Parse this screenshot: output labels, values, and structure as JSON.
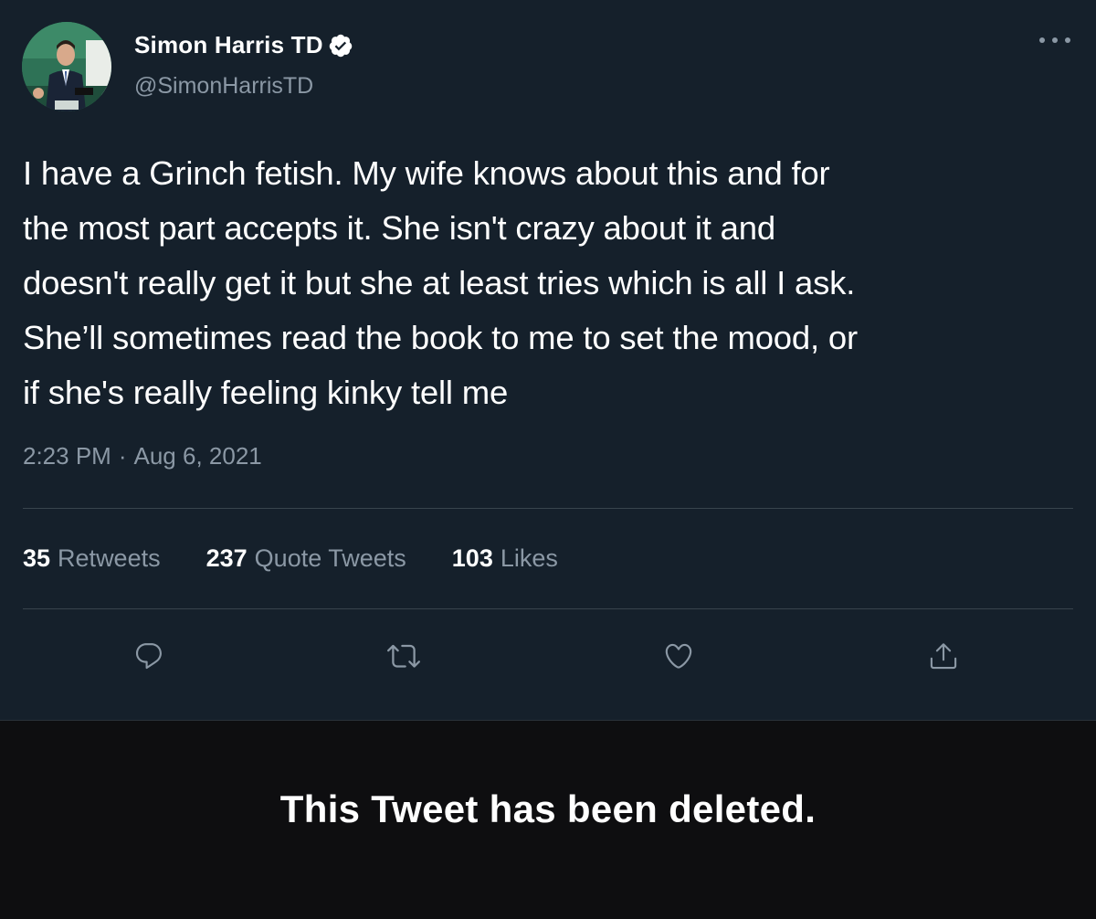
{
  "author": {
    "name": "Simon Harris TD",
    "handle": "@SimonHarrisTD",
    "verified": true,
    "avatar_icon": "profile-photo"
  },
  "menu": {
    "icon": "more-horizontal-icon"
  },
  "tweet": {
    "text": "I have a Grinch fetish. My wife knows about this and for\nthe most part accepts it. She isn't crazy about it and\ndoesn't really get it but she at least tries which is all I ask.\nShe’ll sometimes read the book to me to set the mood, or\nif she's really feeling kinky tell me",
    "time": "2:23 PM",
    "separator": "·",
    "date": "Aug 6, 2021"
  },
  "stats": [
    {
      "count": "35",
      "label": "Retweets"
    },
    {
      "count": "237",
      "label": "Quote Tweets"
    },
    {
      "count": "103",
      "label": "Likes"
    }
  ],
  "actions": [
    {
      "icon": "reply-icon"
    },
    {
      "icon": "retweet-icon"
    },
    {
      "icon": "like-icon"
    },
    {
      "icon": "share-icon"
    }
  ],
  "overlay": {
    "message": "This Tweet has been deleted."
  },
  "colors": {
    "background": "#15202b",
    "text_primary": "#ffffff",
    "text_secondary": "#8b98a5",
    "divider": "#38444d",
    "overlay_background": "#0e0e10"
  }
}
